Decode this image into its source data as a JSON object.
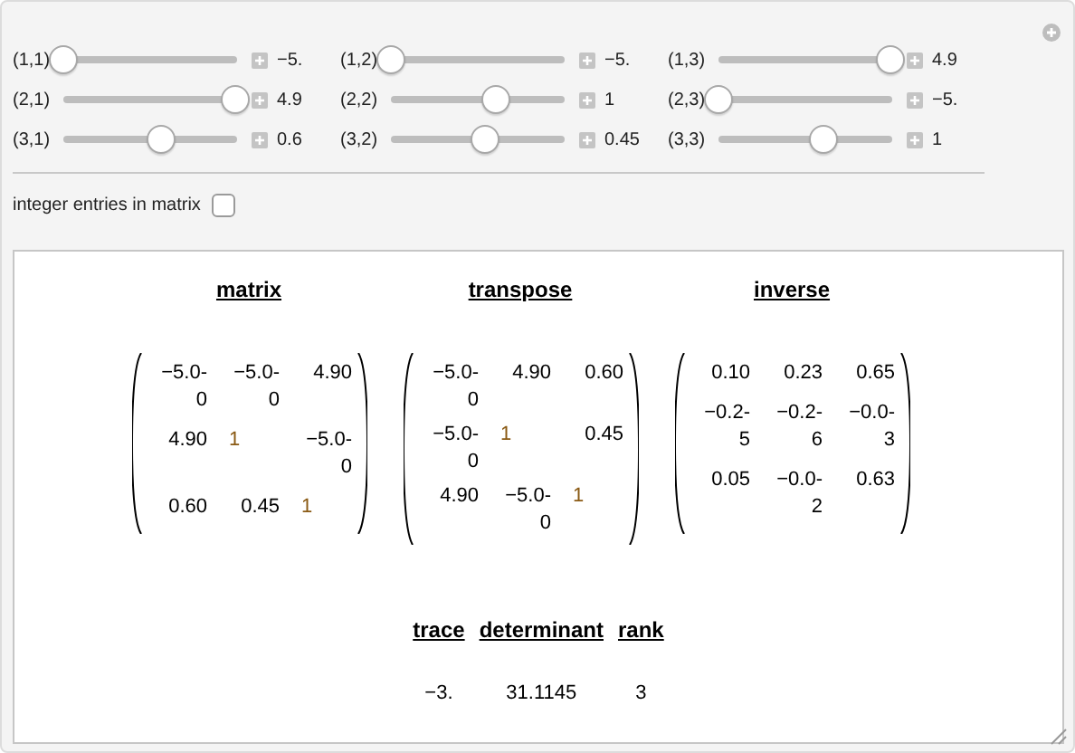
{
  "sliders": [
    {
      "label": "(1,1)",
      "level": 0.0,
      "value": "−5."
    },
    {
      "label": "(1,2)",
      "level": 0.0,
      "value": "−5."
    },
    {
      "label": "(1,3)",
      "level": 0.99,
      "value": "4.9"
    },
    {
      "label": "(2,1)",
      "level": 0.99,
      "value": "4.9"
    },
    {
      "label": "(2,2)",
      "level": 0.6,
      "value": "1"
    },
    {
      "label": "(2,3)",
      "level": 0.0,
      "value": "−5."
    },
    {
      "label": "(3,1)",
      "level": 0.56,
      "value": "0.6"
    },
    {
      "label": "(3,2)",
      "level": 0.545,
      "value": "0.45"
    },
    {
      "label": "(3,3)",
      "level": 0.6,
      "value": "1"
    }
  ],
  "integer_checkbox": {
    "label": "integer entries in matrix",
    "checked": false
  },
  "matrices": [
    {
      "title": "matrix",
      "rows": [
        [
          {
            "kind": "real",
            "lines": [
              "−5.0-",
              "0"
            ]
          },
          {
            "kind": "real",
            "lines": [
              "−5.0-",
              "0"
            ]
          },
          {
            "kind": "real",
            "lines": [
              "4.90"
            ]
          }
        ],
        [
          {
            "kind": "real",
            "lines": [
              "4.90"
            ]
          },
          {
            "kind": "integer",
            "lines": [
              "1"
            ]
          },
          {
            "kind": "real",
            "lines": [
              "−5.0-",
              "0"
            ]
          }
        ],
        [
          {
            "kind": "real",
            "lines": [
              "0.60"
            ]
          },
          {
            "kind": "real",
            "lines": [
              "0.45"
            ]
          },
          {
            "kind": "integer",
            "lines": [
              "1"
            ]
          }
        ]
      ]
    },
    {
      "title": "transpose",
      "rows": [
        [
          {
            "kind": "real",
            "lines": [
              "−5.0-",
              "0"
            ]
          },
          {
            "kind": "real",
            "lines": [
              "4.90"
            ]
          },
          {
            "kind": "real",
            "lines": [
              "0.60"
            ]
          }
        ],
        [
          {
            "kind": "real",
            "lines": [
              "−5.0-",
              "0"
            ]
          },
          {
            "kind": "integer",
            "lines": [
              "1"
            ]
          },
          {
            "kind": "real",
            "lines": [
              "0.45"
            ]
          }
        ],
        [
          {
            "kind": "real",
            "lines": [
              "4.90"
            ]
          },
          {
            "kind": "real",
            "lines": [
              "−5.0-",
              "0"
            ]
          },
          {
            "kind": "integer",
            "lines": [
              "1"
            ]
          }
        ]
      ]
    },
    {
      "title": "inverse",
      "rows": [
        [
          {
            "kind": "real",
            "lines": [
              "0.10"
            ]
          },
          {
            "kind": "real",
            "lines": [
              "0.23"
            ]
          },
          {
            "kind": "real",
            "lines": [
              "0.65"
            ]
          }
        ],
        [
          {
            "kind": "real",
            "lines": [
              "−0.2-",
              "5"
            ]
          },
          {
            "kind": "real",
            "lines": [
              "−0.2-",
              "6"
            ]
          },
          {
            "kind": "real",
            "lines": [
              "−0.0-",
              "3"
            ]
          }
        ],
        [
          {
            "kind": "real",
            "lines": [
              "0.05"
            ]
          },
          {
            "kind": "real",
            "lines": [
              "−0.0-",
              "2"
            ]
          },
          {
            "kind": "real",
            "lines": [
              "0.63"
            ]
          }
        ]
      ]
    }
  ],
  "properties": {
    "headers": [
      "trace",
      "determinant",
      "rank"
    ],
    "values": [
      "−3.",
      "31.1145",
      "3"
    ]
  }
}
